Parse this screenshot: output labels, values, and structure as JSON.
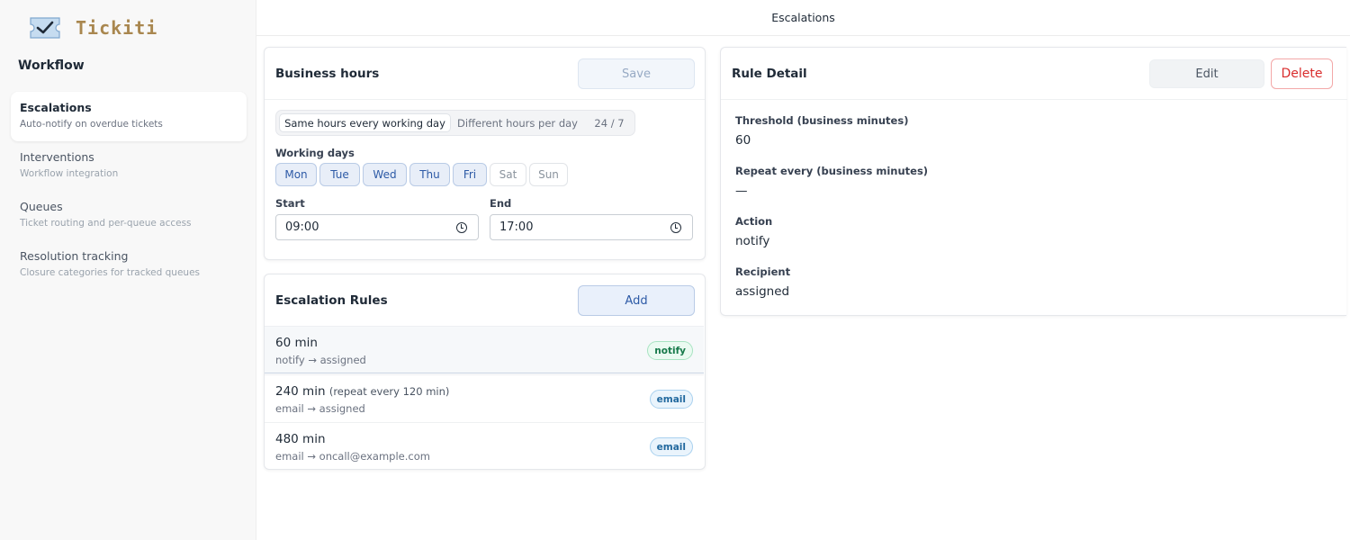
{
  "app": {
    "name": "Tickiti"
  },
  "sidebar": {
    "heading": "Workflow",
    "items": [
      {
        "title": "Escalations",
        "subtitle": "Auto-notify on overdue tickets",
        "active": true
      },
      {
        "title": "Interventions",
        "subtitle": "Workflow integration",
        "active": false
      },
      {
        "title": "Queues",
        "subtitle": "Ticket routing and per-queue access",
        "active": false
      },
      {
        "title": "Resolution tracking",
        "subtitle": "Closure categories for tracked queues",
        "active": false
      }
    ]
  },
  "header": {
    "title": "Escalations"
  },
  "business_hours": {
    "title": "Business hours",
    "save_label": "Save",
    "modes": [
      "Same hours every working day",
      "Different hours per day",
      "24 / 7"
    ],
    "selected_mode": "Same hours every working day",
    "working_days_label": "Working days",
    "days": [
      {
        "label": "Mon",
        "selected": true
      },
      {
        "label": "Tue",
        "selected": true
      },
      {
        "label": "Wed",
        "selected": true
      },
      {
        "label": "Thu",
        "selected": true
      },
      {
        "label": "Fri",
        "selected": true
      },
      {
        "label": "Sat",
        "selected": false
      },
      {
        "label": "Sun",
        "selected": false
      }
    ],
    "start_label": "Start",
    "start_value": "09:00",
    "end_label": "End",
    "end_value": "17:00"
  },
  "escalation_rules": {
    "title": "Escalation Rules",
    "add_label": "Add",
    "rules": [
      {
        "title": "60 min",
        "repeat": "",
        "subtitle": "notify → assigned",
        "badge": "notify",
        "selected": true
      },
      {
        "title": "240 min",
        "repeat": "(repeat every 120 min)",
        "subtitle": "email → assigned",
        "badge": "email",
        "selected": false
      },
      {
        "title": "480 min",
        "repeat": "",
        "subtitle": "email → oncall@example.com",
        "badge": "email",
        "selected": false
      }
    ]
  },
  "rule_detail": {
    "title": "Rule Detail",
    "edit_label": "Edit",
    "delete_label": "Delete",
    "fields": [
      {
        "label": "Threshold (business minutes)",
        "value": "60"
      },
      {
        "label": "Repeat every (business minutes)",
        "value": "—"
      },
      {
        "label": "Action",
        "value": "notify"
      },
      {
        "label": "Recipient",
        "value": "assigned"
      }
    ]
  },
  "colors": {
    "brand": "#a9874f",
    "accent": "#2d5aa6",
    "danger": "#d92d2d",
    "success": "#16794a"
  },
  "icons": {
    "logo": "ticket-check-icon",
    "time": "clock-icon"
  }
}
